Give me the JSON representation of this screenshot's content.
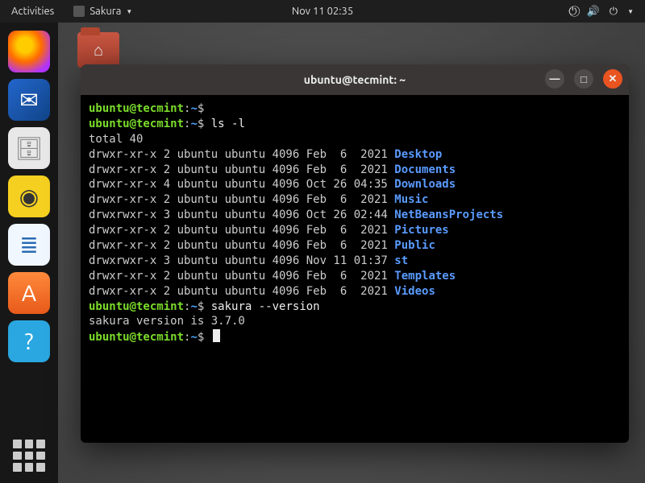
{
  "topbar": {
    "activities": "Activities",
    "app_name": "Sakura",
    "clock": "Nov 11  02:35"
  },
  "desktop": {
    "home_folder": ""
  },
  "dock": {
    "firefox": "firefox",
    "thunderbird": "thunderbird",
    "files": "files",
    "rhythmbox": "rhythmbox",
    "writer": "writer",
    "software": "software",
    "help": "help"
  },
  "window_title": "ubuntu@tecmint: ~",
  "prompt": {
    "user": "ubuntu",
    "at": "@",
    "host": "tecmint",
    "colon": ":",
    "path": "~",
    "sigil": "$"
  },
  "cmd_ls": "ls -l",
  "total_line": "total 40",
  "ls": [
    {
      "meta": "drwxr-xr-x 2 ubuntu ubuntu 4096 Feb  6  2021 ",
      "name": "Desktop"
    },
    {
      "meta": "drwxr-xr-x 2 ubuntu ubuntu 4096 Feb  6  2021 ",
      "name": "Documents"
    },
    {
      "meta": "drwxr-xr-x 4 ubuntu ubuntu 4096 Oct 26 04:35 ",
      "name": "Downloads"
    },
    {
      "meta": "drwxr-xr-x 2 ubuntu ubuntu 4096 Feb  6  2021 ",
      "name": "Music"
    },
    {
      "meta": "drwxrwxr-x 3 ubuntu ubuntu 4096 Oct 26 02:44 ",
      "name": "NetBeansProjects"
    },
    {
      "meta": "drwxr-xr-x 2 ubuntu ubuntu 4096 Feb  6  2021 ",
      "name": "Pictures"
    },
    {
      "meta": "drwxr-xr-x 2 ubuntu ubuntu 4096 Feb  6  2021 ",
      "name": "Public"
    },
    {
      "meta": "drwxrwxr-x 3 ubuntu ubuntu 4096 Nov 11 01:37 ",
      "name": "st"
    },
    {
      "meta": "drwxr-xr-x 2 ubuntu ubuntu 4096 Feb  6  2021 ",
      "name": "Templates"
    },
    {
      "meta": "drwxr-xr-x 2 ubuntu ubuntu 4096 Feb  6  2021 ",
      "name": "Videos"
    }
  ],
  "cmd_version": "sakura --version",
  "version_output": "sakura version is 3.7.0"
}
